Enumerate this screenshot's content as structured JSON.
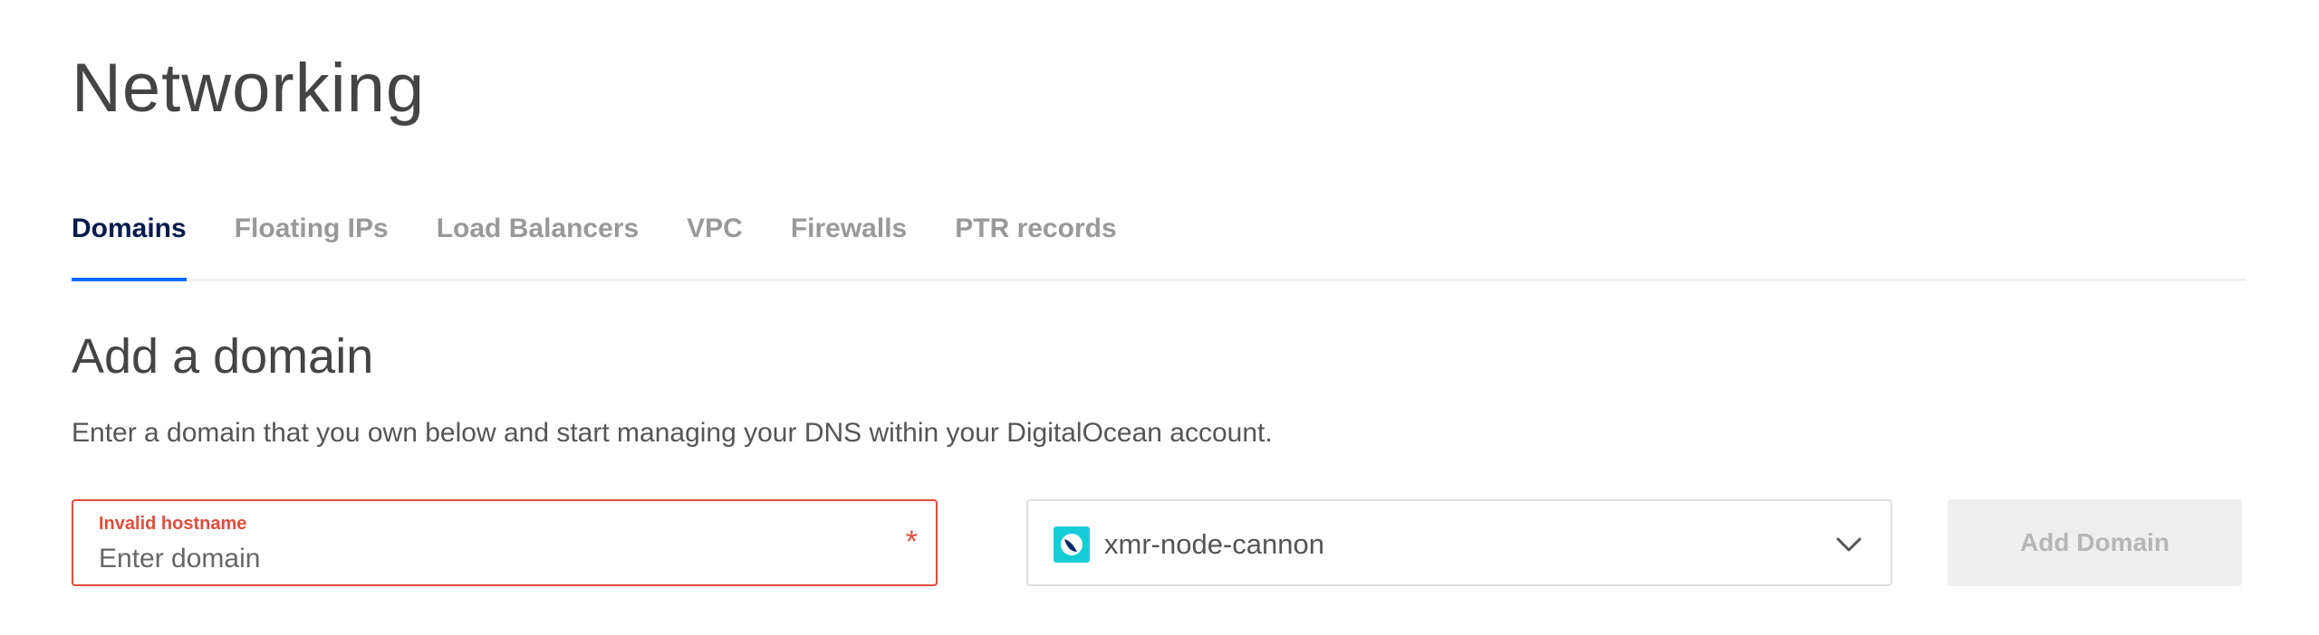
{
  "page": {
    "title": "Networking"
  },
  "tabs": [
    {
      "label": "Domains",
      "active": true
    },
    {
      "label": "Floating IPs",
      "active": false
    },
    {
      "label": "Load Balancers",
      "active": false
    },
    {
      "label": "VPC",
      "active": false
    },
    {
      "label": "Firewalls",
      "active": false
    },
    {
      "label": "PTR records",
      "active": false
    }
  ],
  "add_domain": {
    "title": "Add a domain",
    "description": "Enter a domain that you own below and start managing your DNS within your DigitalOcean account.",
    "domain_input": {
      "error_label": "Invalid hostname",
      "placeholder": "Enter domain",
      "value": "",
      "required_mark": "*"
    },
    "droplet_select": {
      "selected": "xmr-node-cannon",
      "icon": "droplet-icon"
    },
    "submit_label": "Add Domain"
  },
  "colors": {
    "accent": "#0069ff",
    "active_tab_text": "#031b4e",
    "error": "#e14c3c",
    "disabled_button_bg": "#efefef",
    "droplet_icon_bg": "#15cdd6"
  }
}
